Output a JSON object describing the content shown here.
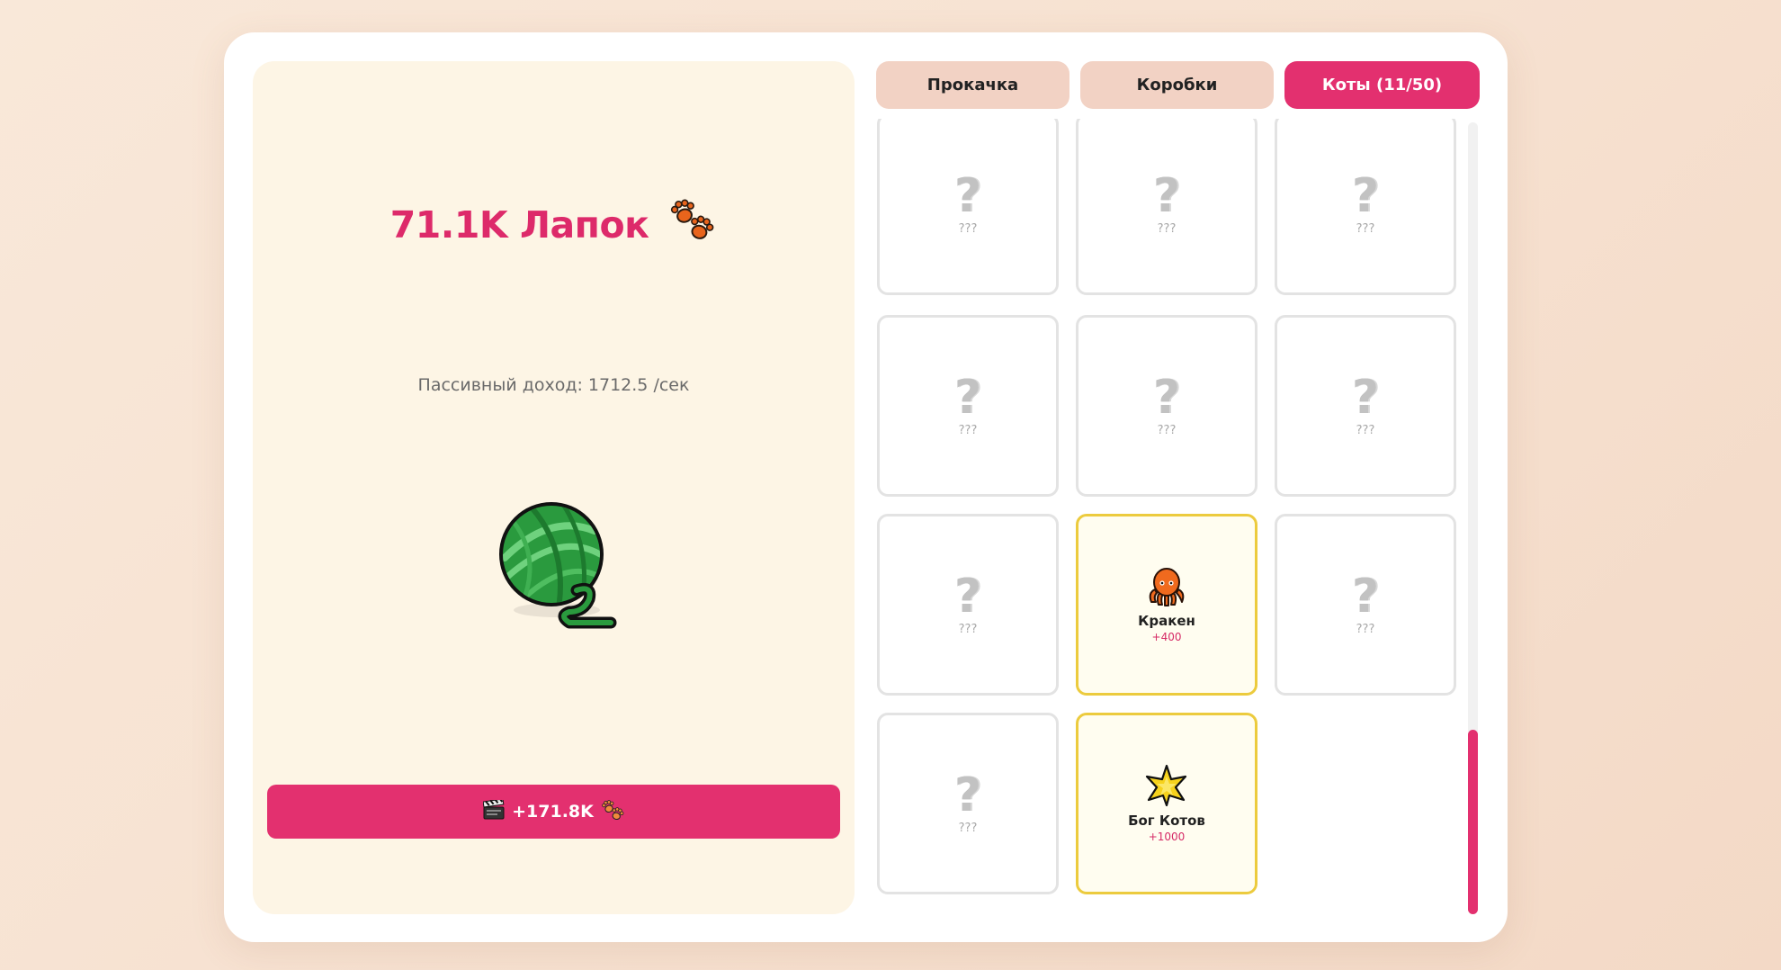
{
  "score": {
    "amount_text": "71.1K Лапок",
    "icon": "paw-prints-icon"
  },
  "passive_income": {
    "text": "Пассивный доход: 1712.5 /сек"
  },
  "click_target": {
    "icon": "yarn-ball-icon",
    "color": "#2ea84a"
  },
  "ad_button": {
    "icon": "clapper-board-icon",
    "label": "+171.8K",
    "reward_icon": "paw-prints-icon"
  },
  "tabs": [
    {
      "label": "Прокачка",
      "active": false
    },
    {
      "label": "Коробки",
      "active": false
    },
    {
      "label": "Коты (11/50)",
      "active": true
    }
  ],
  "cats": [
    {
      "locked": true,
      "name": "???"
    },
    {
      "locked": true,
      "name": "???"
    },
    {
      "locked": true,
      "name": "???"
    },
    {
      "locked": true,
      "name": "???"
    },
    {
      "locked": true,
      "name": "???"
    },
    {
      "locked": true,
      "name": "???"
    },
    {
      "locked": true,
      "name": "???"
    },
    {
      "locked": false,
      "name": "Кракен",
      "bonus": "+400",
      "icon": "octopus-icon"
    },
    {
      "locked": true,
      "name": "???"
    },
    {
      "locked": true,
      "name": "???"
    },
    {
      "locked": false,
      "name": "Бог Котов",
      "bonus": "+1000",
      "icon": "star-icon"
    }
  ],
  "colors": {
    "accent": "#e3306f",
    "tab_inactive": "#f2d2c4",
    "left_panel": "#fdf5e5",
    "unlocked_border": "#eccb3e"
  }
}
